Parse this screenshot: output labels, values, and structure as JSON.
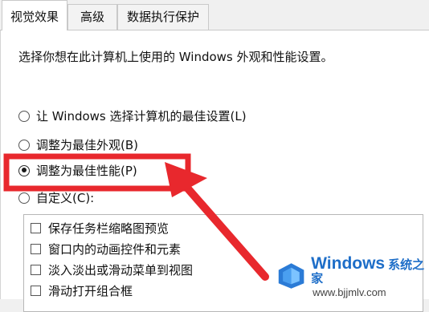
{
  "tabs": [
    {
      "label": "视觉效果",
      "active": true
    },
    {
      "label": "高级",
      "active": false
    },
    {
      "label": "数据执行保护",
      "active": false
    }
  ],
  "description": "选择你想在此计算机上使用的 Windows 外观和性能设置。",
  "radio_options": [
    {
      "label": "让 Windows 选择计算机的最佳设置(L)",
      "checked": false
    },
    {
      "label": "调整为最佳外观(B)",
      "checked": false
    },
    {
      "label": "调整为最佳性能(P)",
      "checked": true
    },
    {
      "label": "自定义(C):",
      "checked": false
    }
  ],
  "custom_options": [
    {
      "label": "保存任务栏缩略图预览",
      "checked": false
    },
    {
      "label": "窗口内的动画控件和元素",
      "checked": false
    },
    {
      "label": "淡入淡出或滑动菜单到视图",
      "checked": false
    },
    {
      "label": "滑动打开组合框",
      "checked": false
    }
  ],
  "annotation": {
    "color": "#e8282d",
    "icon": "red-arrow-and-highlight-box"
  },
  "watermark": {
    "brand": "Windows",
    "suffix": "系统之家",
    "url": "www.bjjmlv.com"
  }
}
